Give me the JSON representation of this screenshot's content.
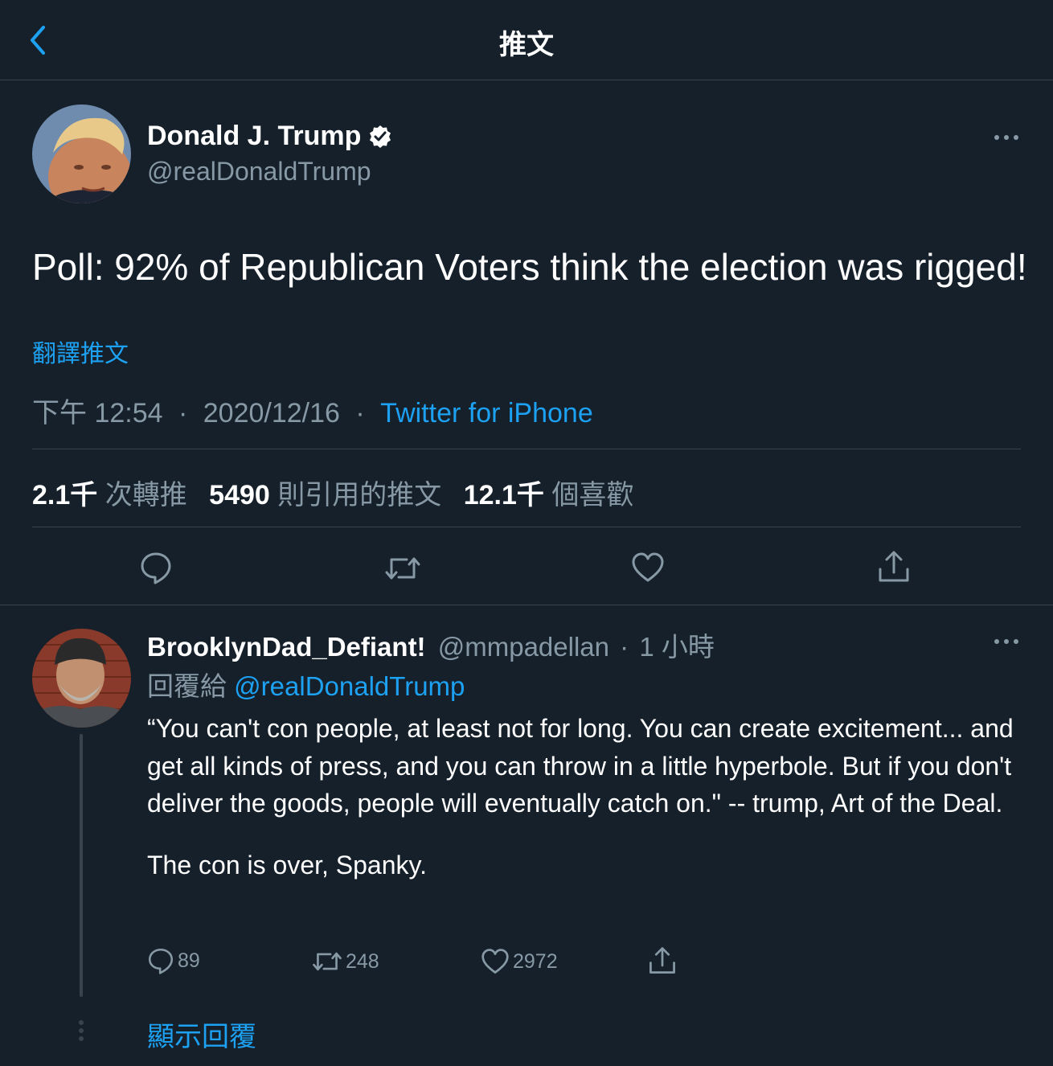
{
  "header": {
    "title": "推文"
  },
  "tweet": {
    "author_name": "Donald J. Trump",
    "author_handle": "@realDonaldTrump",
    "text": "Poll: 92% of Republican Voters think the election was rigged!",
    "translate_label": "翻譯推文",
    "time": "下午 12:54",
    "sep1": "·",
    "date": "2020/12/16",
    "sep2": "·",
    "source": "Twitter for iPhone",
    "stats": {
      "retweets_count": "2.1千",
      "retweets_label": "次轉推",
      "quotes_count": "5490",
      "quotes_label": "則引用的推文",
      "likes_count": "12.1千",
      "likes_label": "個喜歡"
    }
  },
  "reply": {
    "author_name": "BrooklynDad_Defiant!",
    "author_handle": "@mmpadellan",
    "sep": "·",
    "time": "1 小時",
    "replying_to_label": "回覆給",
    "replying_to_handle": "@realDonaldTrump",
    "text_p1": "“You can't con people, at least not for long. You can create excitement... and get all kinds of press, and you can throw in a little hyperbole. But if you don't deliver the goods, people will eventually catch on.\" -- trump, Art of the Deal.",
    "text_p2": "The con is over, Spanky.",
    "reply_count": "89",
    "retweet_count": "248",
    "like_count": "2972",
    "show_replies_label": "顯示回覆"
  },
  "colors": {
    "background": "#15202b",
    "divider": "#38444d",
    "accent": "#1da1f2",
    "muted": "#8899a6"
  }
}
